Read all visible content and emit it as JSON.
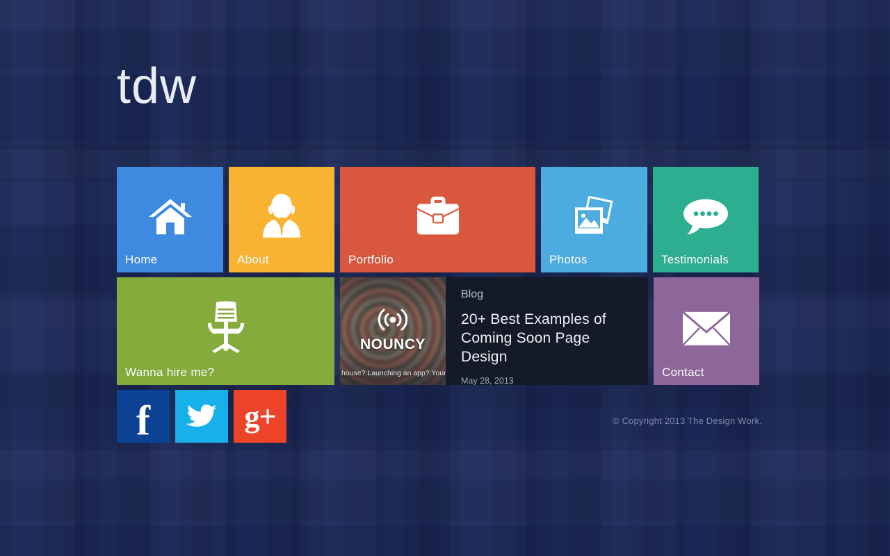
{
  "site": {
    "logo": "tdw",
    "background_color": "#1d2a5c"
  },
  "tiles": [
    {
      "id": "home",
      "label": "Home",
      "icon": "house-icon",
      "color": "#3d8ae0"
    },
    {
      "id": "about",
      "label": "About",
      "icon": "person-tie-icon",
      "color": "#f9b332"
    },
    {
      "id": "portfolio",
      "label": "Portfolio",
      "icon": "briefcase-icon",
      "color": "#d9573f"
    },
    {
      "id": "photos",
      "label": "Photos",
      "icon": "photos-stack-icon",
      "color": "#4cabdf"
    },
    {
      "id": "testimonials",
      "label": "Testimonials",
      "icon": "speech-bubble-icon",
      "color": "#2dae91"
    },
    {
      "id": "hire",
      "label": "Wanna hire me?",
      "icon": "office-chair-icon",
      "color": "#84ab3c"
    },
    {
      "id": "contact",
      "label": "Contact",
      "icon": "envelope-icon",
      "color": "#8d6799"
    }
  ],
  "blog": {
    "kicker": "Blog",
    "title": "20+ Best Examples of Coming Soon Page Design",
    "date": "May 28, 2013",
    "background_color": "#141a27",
    "thumbnail": {
      "brand": "NOUNCY",
      "icon": "broadcast-signal-icon",
      "caption": "house? Launching an app? Your dog"
    }
  },
  "social": [
    {
      "id": "facebook",
      "label": "f",
      "icon": "facebook-icon",
      "color": "#0b4294"
    },
    {
      "id": "twitter",
      "label": "",
      "icon": "twitter-icon",
      "color": "#18b0e8"
    },
    {
      "id": "googleplus",
      "label": "g+",
      "icon": "google-plus-icon",
      "color": "#ed4328"
    }
  ],
  "footer": {
    "copyright": "© Copyright 2013 The Design Work."
  }
}
